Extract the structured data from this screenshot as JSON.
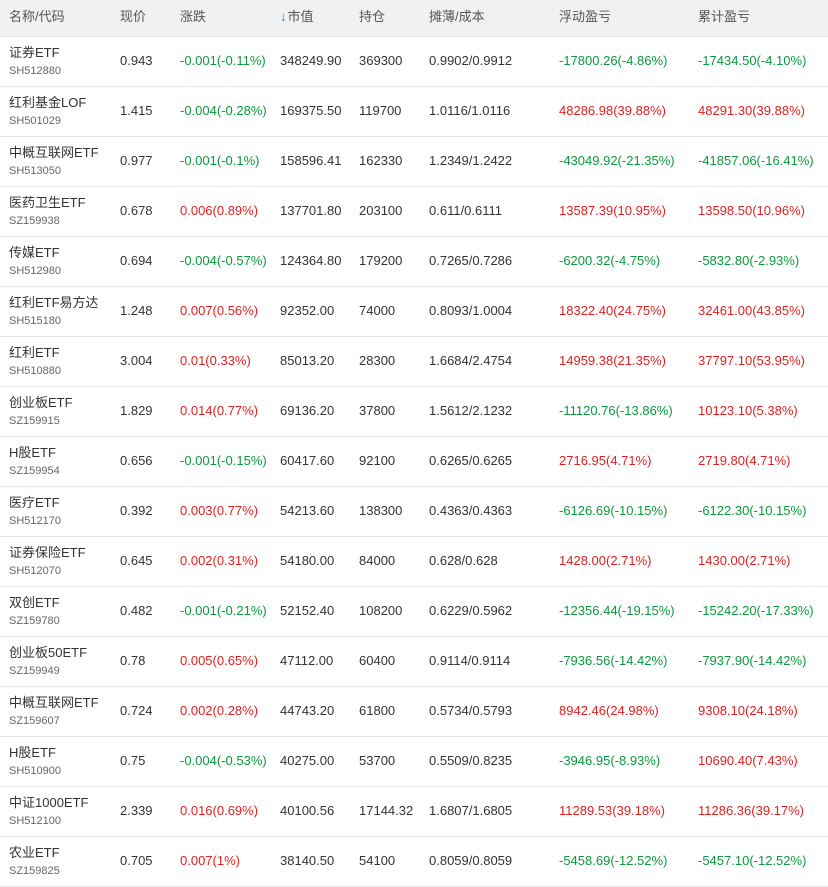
{
  "colors": {
    "up": "#e02020",
    "down": "#0a9a3c",
    "sort_icon": "#1e78d2"
  },
  "header": {
    "name": "名称/代码",
    "price": "现价",
    "change": "涨跌",
    "sort_icon": "down-arrow-icon",
    "sort_glyph": "↓",
    "market_value": "市值",
    "position": "持仓",
    "cost": "摊薄/成本",
    "float_pnl": "浮动盈亏",
    "cum_pnl": "累计盈亏"
  },
  "rows": [
    {
      "name": "证券ETF",
      "code": "SH512880",
      "price": "0.943",
      "change": "-0.001(-0.11%)",
      "change_dir": "down",
      "market_value": "348249.90",
      "position": "369300",
      "cost": "0.9902/0.9912",
      "float_pnl": "-17800.26(-4.86%)",
      "float_dir": "down",
      "cum_pnl": "-17434.50(-4.10%)",
      "cum_dir": "down"
    },
    {
      "name": "红利基金LOF",
      "code": "SH501029",
      "price": "1.415",
      "change": "-0.004(-0.28%)",
      "change_dir": "down",
      "market_value": "169375.50",
      "position": "119700",
      "cost": "1.0116/1.0116",
      "float_pnl": "48286.98(39.88%)",
      "float_dir": "up",
      "cum_pnl": "48291.30(39.88%)",
      "cum_dir": "up"
    },
    {
      "name": "中概互联网ETF",
      "code": "SH513050",
      "price": "0.977",
      "change": "-0.001(-0.1%)",
      "change_dir": "down",
      "market_value": "158596.41",
      "position": "162330",
      "cost": "1.2349/1.2422",
      "float_pnl": "-43049.92(-21.35%)",
      "float_dir": "down",
      "cum_pnl": "-41857.06(-16.41%)",
      "cum_dir": "down"
    },
    {
      "name": "医药卫生ETF",
      "code": "SZ159938",
      "price": "0.678",
      "change": "0.006(0.89%)",
      "change_dir": "up",
      "market_value": "137701.80",
      "position": "203100",
      "cost": "0.611/0.6111",
      "float_pnl": "13587.39(10.95%)",
      "float_dir": "up",
      "cum_pnl": "13598.50(10.96%)",
      "cum_dir": "up"
    },
    {
      "name": "传媒ETF",
      "code": "SH512980",
      "price": "0.694",
      "change": "-0.004(-0.57%)",
      "change_dir": "down",
      "market_value": "124364.80",
      "position": "179200",
      "cost": "0.7265/0.7286",
      "float_pnl": "-6200.32(-4.75%)",
      "float_dir": "down",
      "cum_pnl": "-5832.80(-2.93%)",
      "cum_dir": "down"
    },
    {
      "name": "红利ETF易方达",
      "code": "SH515180",
      "price": "1.248",
      "change": "0.007(0.56%)",
      "change_dir": "up",
      "market_value": "92352.00",
      "position": "74000",
      "cost": "0.8093/1.0004",
      "float_pnl": "18322.40(24.75%)",
      "float_dir": "up",
      "cum_pnl": "32461.00(43.85%)",
      "cum_dir": "up"
    },
    {
      "name": "红利ETF",
      "code": "SH510880",
      "price": "3.004",
      "change": "0.01(0.33%)",
      "change_dir": "up",
      "market_value": "85013.20",
      "position": "28300",
      "cost": "1.6684/2.4754",
      "float_pnl": "14959.38(21.35%)",
      "float_dir": "up",
      "cum_pnl": "37797.10(53.95%)",
      "cum_dir": "up"
    },
    {
      "name": "创业板ETF",
      "code": "SZ159915",
      "price": "1.829",
      "change": "0.014(0.77%)",
      "change_dir": "up",
      "market_value": "69136.20",
      "position": "37800",
      "cost": "1.5612/2.1232",
      "float_pnl": "-11120.76(-13.86%)",
      "float_dir": "down",
      "cum_pnl": "10123.10(5.38%)",
      "cum_dir": "up"
    },
    {
      "name": "H股ETF",
      "code": "SZ159954",
      "price": "0.656",
      "change": "-0.001(-0.15%)",
      "change_dir": "down",
      "market_value": "60417.60",
      "position": "92100",
      "cost": "0.6265/0.6265",
      "float_pnl": "2716.95(4.71%)",
      "float_dir": "up",
      "cum_pnl": "2719.80(4.71%)",
      "cum_dir": "up"
    },
    {
      "name": "医疗ETF",
      "code": "SH512170",
      "price": "0.392",
      "change": "0.003(0.77%)",
      "change_dir": "up",
      "market_value": "54213.60",
      "position": "138300",
      "cost": "0.4363/0.4363",
      "float_pnl": "-6126.69(-10.15%)",
      "float_dir": "down",
      "cum_pnl": "-6122.30(-10.15%)",
      "cum_dir": "down"
    },
    {
      "name": "证券保险ETF",
      "code": "SH512070",
      "price": "0.645",
      "change": "0.002(0.31%)",
      "change_dir": "up",
      "market_value": "54180.00",
      "position": "84000",
      "cost": "0.628/0.628",
      "float_pnl": "1428.00(2.71%)",
      "float_dir": "up",
      "cum_pnl": "1430.00(2.71%)",
      "cum_dir": "up"
    },
    {
      "name": "双创ETF",
      "code": "SZ159780",
      "price": "0.482",
      "change": "-0.001(-0.21%)",
      "change_dir": "down",
      "market_value": "52152.40",
      "position": "108200",
      "cost": "0.6229/0.5962",
      "float_pnl": "-12356.44(-19.15%)",
      "float_dir": "down",
      "cum_pnl": "-15242.20(-17.33%)",
      "cum_dir": "down"
    },
    {
      "name": "创业板50ETF",
      "code": "SZ159949",
      "price": "0.78",
      "change": "0.005(0.65%)",
      "change_dir": "up",
      "market_value": "47112.00",
      "position": "60400",
      "cost": "0.9114/0.9114",
      "float_pnl": "-7936.56(-14.42%)",
      "float_dir": "down",
      "cum_pnl": "-7937.90(-14.42%)",
      "cum_dir": "down"
    },
    {
      "name": "中概互联网ETF",
      "code": "SZ159607",
      "price": "0.724",
      "change": "0.002(0.28%)",
      "change_dir": "up",
      "market_value": "44743.20",
      "position": "61800",
      "cost": "0.5734/0.5793",
      "float_pnl": "8942.46(24.98%)",
      "float_dir": "up",
      "cum_pnl": "9308.10(24.18%)",
      "cum_dir": "up"
    },
    {
      "name": "H股ETF",
      "code": "SH510900",
      "price": "0.75",
      "change": "-0.004(-0.53%)",
      "change_dir": "down",
      "market_value": "40275.00",
      "position": "53700",
      "cost": "0.5509/0.8235",
      "float_pnl": "-3946.95(-8.93%)",
      "float_dir": "down",
      "cum_pnl": "10690.40(7.43%)",
      "cum_dir": "up"
    },
    {
      "name": "中证1000ETF",
      "code": "SH512100",
      "price": "2.339",
      "change": "0.016(0.69%)",
      "change_dir": "up",
      "market_value": "40100.56",
      "position": "17144.32",
      "cost": "1.6807/1.6805",
      "float_pnl": "11289.53(39.18%)",
      "float_dir": "up",
      "cum_pnl": "11286.36(39.17%)",
      "cum_dir": "up"
    },
    {
      "name": "农业ETF",
      "code": "SZ159825",
      "price": "0.705",
      "change": "0.007(1%)",
      "change_dir": "up",
      "market_value": "38140.50",
      "position": "54100",
      "cost": "0.8059/0.8059",
      "float_pnl": "-5458.69(-12.52%)",
      "float_dir": "down",
      "cum_pnl": "-5457.10(-12.52%)",
      "cum_dir": "down"
    }
  ]
}
